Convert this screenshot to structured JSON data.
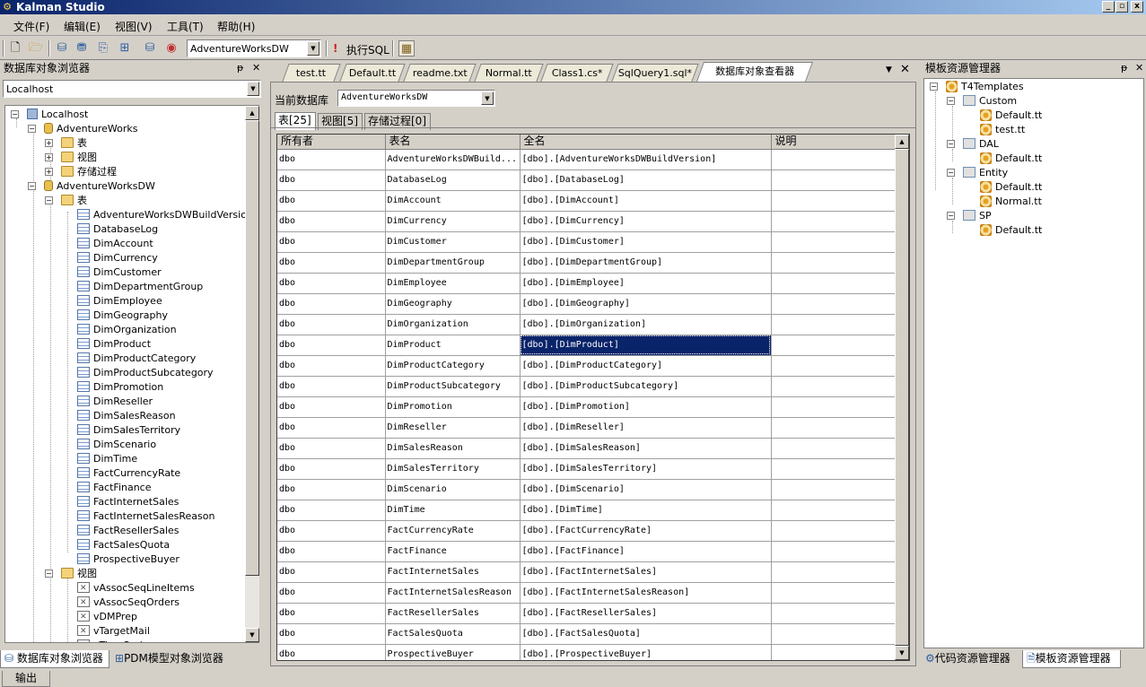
{
  "window": {
    "title": "Kalman Studio",
    "controls": [
      "_",
      "▫",
      "x"
    ]
  },
  "menu": [
    "文件(F)",
    "编辑(E)",
    "视图(V)",
    "工具(T)",
    "帮助(H)"
  ],
  "toolbar": {
    "database_combo": "AdventureWorksDW",
    "exec_label": "执行SQL"
  },
  "left_panel": {
    "title": "数据库对象浏览器",
    "pin": "ᵽ",
    "close": "✕",
    "server_combo": "Localhost",
    "tree": {
      "root": "Localhost",
      "db1": "AdventureWorks",
      "db1_children": [
        "表",
        "视图",
        "存储过程"
      ],
      "db2": "AdventureWorksDW",
      "tables_folder": "表",
      "tables": [
        "AdventureWorksDWBuildVersion",
        "DatabaseLog",
        "DimAccount",
        "DimCurrency",
        "DimCustomer",
        "DimDepartmentGroup",
        "DimEmployee",
        "DimGeography",
        "DimOrganization",
        "DimProduct",
        "DimProductCategory",
        "DimProductSubcategory",
        "DimPromotion",
        "DimReseller",
        "DimSalesReason",
        "DimSalesTerritory",
        "DimScenario",
        "DimTime",
        "FactCurrencyRate",
        "FactFinance",
        "FactInternetSales",
        "FactInternetSalesReason",
        "FactResellerSales",
        "FactSalesQuota",
        "ProspectiveBuyer"
      ],
      "views_folder": "视图",
      "views": [
        "vAssocSeqLineItems",
        "vAssocSeqOrders",
        "vDMPrep",
        "vTargetMail",
        "vTimeSeries"
      ]
    },
    "bottom_tabs": [
      "数据库对象浏览器",
      "PDM模型对象浏览器"
    ]
  },
  "center": {
    "doc_tabs": [
      "test.tt",
      "Default.tt",
      "readme.txt",
      "Normal.tt",
      "Class1.cs*",
      "SqlQuery1.sql*",
      "数据库对象查看器"
    ],
    "db_label": "当前数据库",
    "db_combo": "AdventureWorksDW",
    "sub_tabs": [
      "表[25]",
      "视图[5]",
      "存储过程[0]"
    ],
    "columns": [
      "所有者",
      "表名",
      "全名",
      "说明"
    ],
    "rows": [
      [
        "dbo",
        "AdventureWorksDWBuild...",
        "[dbo].[AdventureWorksDWBuildVersion]",
        ""
      ],
      [
        "dbo",
        "DatabaseLog",
        "[dbo].[DatabaseLog]",
        ""
      ],
      [
        "dbo",
        "DimAccount",
        "[dbo].[DimAccount]",
        ""
      ],
      [
        "dbo",
        "DimCurrency",
        "[dbo].[DimCurrency]",
        ""
      ],
      [
        "dbo",
        "DimCustomer",
        "[dbo].[DimCustomer]",
        ""
      ],
      [
        "dbo",
        "DimDepartmentGroup",
        "[dbo].[DimDepartmentGroup]",
        ""
      ],
      [
        "dbo",
        "DimEmployee",
        "[dbo].[DimEmployee]",
        ""
      ],
      [
        "dbo",
        "DimGeography",
        "[dbo].[DimGeography]",
        ""
      ],
      [
        "dbo",
        "DimOrganization",
        "[dbo].[DimOrganization]",
        ""
      ],
      [
        "dbo",
        "DimProduct",
        "[dbo].[DimProduct]",
        ""
      ],
      [
        "dbo",
        "DimProductCategory",
        "[dbo].[DimProductCategory]",
        ""
      ],
      [
        "dbo",
        "DimProductSubcategory",
        "[dbo].[DimProductSubcategory]",
        ""
      ],
      [
        "dbo",
        "DimPromotion",
        "[dbo].[DimPromotion]",
        ""
      ],
      [
        "dbo",
        "DimReseller",
        "[dbo].[DimReseller]",
        ""
      ],
      [
        "dbo",
        "DimSalesReason",
        "[dbo].[DimSalesReason]",
        ""
      ],
      [
        "dbo",
        "DimSalesTerritory",
        "[dbo].[DimSalesTerritory]",
        ""
      ],
      [
        "dbo",
        "DimScenario",
        "[dbo].[DimScenario]",
        ""
      ],
      [
        "dbo",
        "DimTime",
        "[dbo].[DimTime]",
        ""
      ],
      [
        "dbo",
        "FactCurrencyRate",
        "[dbo].[FactCurrencyRate]",
        ""
      ],
      [
        "dbo",
        "FactFinance",
        "[dbo].[FactFinance]",
        ""
      ],
      [
        "dbo",
        "FactInternetSales",
        "[dbo].[FactInternetSales]",
        ""
      ],
      [
        "dbo",
        "FactInternetSalesReason",
        "[dbo].[FactInternetSalesReason]",
        ""
      ],
      [
        "dbo",
        "FactResellerSales",
        "[dbo].[FactResellerSales]",
        ""
      ],
      [
        "dbo",
        "FactSalesQuota",
        "[dbo].[FactSalesQuota]",
        ""
      ],
      [
        "dbo",
        "ProspectiveBuyer",
        "[dbo].[ProspectiveBuyer]",
        ""
      ]
    ],
    "selected_row": 9,
    "selected_col": 2
  },
  "right_panel": {
    "title": "模板资源管理器",
    "tree": {
      "root": "T4Templates",
      "folders": [
        {
          "name": "Custom",
          "files": [
            "Default.tt",
            "test.tt"
          ]
        },
        {
          "name": "DAL",
          "files": [
            "Default.tt"
          ]
        },
        {
          "name": "Entity",
          "files": [
            "Default.tt",
            "Normal.tt"
          ]
        },
        {
          "name": "SP",
          "files": [
            "Default.tt"
          ]
        }
      ]
    },
    "bottom_tabs": [
      "代码资源管理器",
      "模板资源管理器"
    ]
  },
  "status": {
    "output_tab": "输出"
  },
  "colors": {
    "selection": "#0a246a",
    "title_start": "#0a246a",
    "title_end": "#a6caf0",
    "chrome": "#d4d0c8"
  }
}
